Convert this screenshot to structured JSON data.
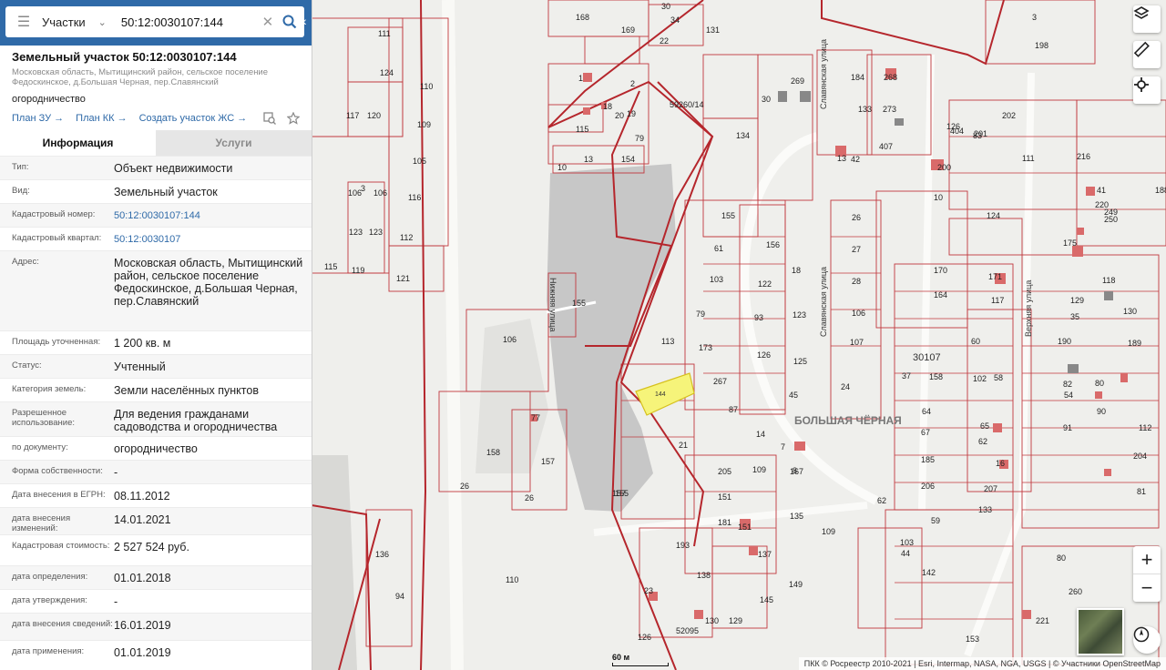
{
  "search": {
    "category": "Участки",
    "query": "50:12:0030107:144"
  },
  "object": {
    "title": "Земельный участок 50:12:0030107:144",
    "address_short": "Московская область, Мытищинский район, сельское поселение Федоскинское, д.Большая Черная, пер.Славянский",
    "usage": "огородничество",
    "links": [
      "План ЗУ",
      "План КК",
      "Создать участок ЖС"
    ],
    "arrow": "→"
  },
  "tabs": [
    {
      "label": "Информация",
      "active": true
    },
    {
      "label": "Услуги",
      "active": false
    }
  ],
  "info": [
    {
      "key": "Тип:",
      "value": "Объект недвижимости"
    },
    {
      "key": "Вид:",
      "value": "Земельный участок"
    },
    {
      "key": "Кадастровый номер:",
      "value": "50:12:0030107:144",
      "link": true
    },
    {
      "key": "Кадастровый квартал:",
      "value": "50:12:0030107",
      "link": true
    },
    {
      "key": "Адрес:",
      "value": "Московская область, Мытищинский район, сельское поселение Федоскинское, д.Большая Черная, пер.Славянский"
    },
    {
      "key": "Площадь уточненная:",
      "value": "1 200 кв. м"
    },
    {
      "key": "Статус:",
      "value": "Учтенный"
    },
    {
      "key": "Категория земель:",
      "value": "Земли населённых пунктов"
    },
    {
      "key": "Разрешенное использование:",
      "value": "Для ведения гражданами садоводства и огородничества"
    },
    {
      "key": "по документу:",
      "value": "огородничество"
    },
    {
      "key": "Форма собственности:",
      "value": "-"
    },
    {
      "key": "Дата внесения в ЕГРН:",
      "value": "08.11.2012"
    },
    {
      "key": "дата внесения изменений:",
      "value": "14.01.2021"
    },
    {
      "key": "Кадастровая стоимость:",
      "value": "2 527 524 руб."
    },
    {
      "key": "дата определения:",
      "value": "01.01.2018"
    },
    {
      "key": "дата утверждения:",
      "value": "-"
    },
    {
      "key": "дата внесения сведений:",
      "value": "16.01.2019"
    },
    {
      "key": "дата применения:",
      "value": "01.01.2019"
    }
  ],
  "map": {
    "quarter_label": "30107",
    "selected_parcel": "144",
    "place_label": "БОЛЬШАЯ ЧЁРНАЯ",
    "streets": [
      "Славянская улица",
      "Нижняя улица",
      "Верхняя улица",
      "Славянская улица",
      "улица"
    ],
    "parcel_numbers": [
      "168",
      "30",
      "34",
      "131",
      "169",
      "22",
      "111",
      "124",
      "110",
      "117",
      "120",
      "109",
      "105",
      "116",
      "106",
      "106",
      "123",
      "123",
      "112",
      "115",
      "119",
      "121",
      "1",
      "2",
      "18",
      "20",
      "19",
      "115",
      "79",
      "10",
      "13",
      "154",
      "59260/14",
      "134",
      "30",
      "269",
      "184",
      "268",
      "3",
      "198",
      "3",
      "106",
      "77",
      "158",
      "157",
      "26",
      "26",
      "157",
      "155",
      "155",
      "155",
      "61",
      "103",
      "79",
      "113",
      "173",
      "267",
      "87",
      "14",
      "21",
      "156",
      "18",
      "122",
      "123",
      "93",
      "126",
      "125",
      "45",
      "7",
      "8",
      "205",
      "109",
      "151",
      "181",
      "151",
      "137",
      "193",
      "138",
      "167",
      "135",
      "109",
      "23",
      "126",
      "52095",
      "130",
      "129",
      "145",
      "149",
      "26",
      "27",
      "28",
      "106",
      "107",
      "24",
      "13",
      "42",
      "133",
      "273",
      "407",
      "126",
      "404",
      "83",
      "202",
      "200",
      "201",
      "111",
      "10",
      "124",
      "216",
      "41",
      "220",
      "249",
      "250",
      "175",
      "188",
      "170",
      "171",
      "164",
      "117",
      "118",
      "129",
      "130",
      "35",
      "190",
      "189",
      "37",
      "158",
      "102",
      "58",
      "60",
      "64",
      "67",
      "65",
      "62",
      "185",
      "16",
      "206",
      "207",
      "133",
      "59",
      "103",
      "44",
      "142",
      "153",
      "82",
      "80",
      "54",
      "90",
      "91",
      "112",
      "204",
      "81",
      "80",
      "260",
      "221",
      "110",
      "136",
      "94",
      "62",
      "33",
      "148",
      "682",
      "58",
      "117",
      "150"
    ],
    "attribution": "ПКК © Росреестр 2010-2021 | Esri, Intermap, NASA, NGA, USGS | © Участники OpenStreetMap",
    "scale_label": "60 м"
  },
  "colors": {
    "header_blue": "#2f6aa8",
    "parcel_stroke": "#c0383e",
    "selected_fill": "#f6f47a",
    "building": "#d96a6a"
  }
}
